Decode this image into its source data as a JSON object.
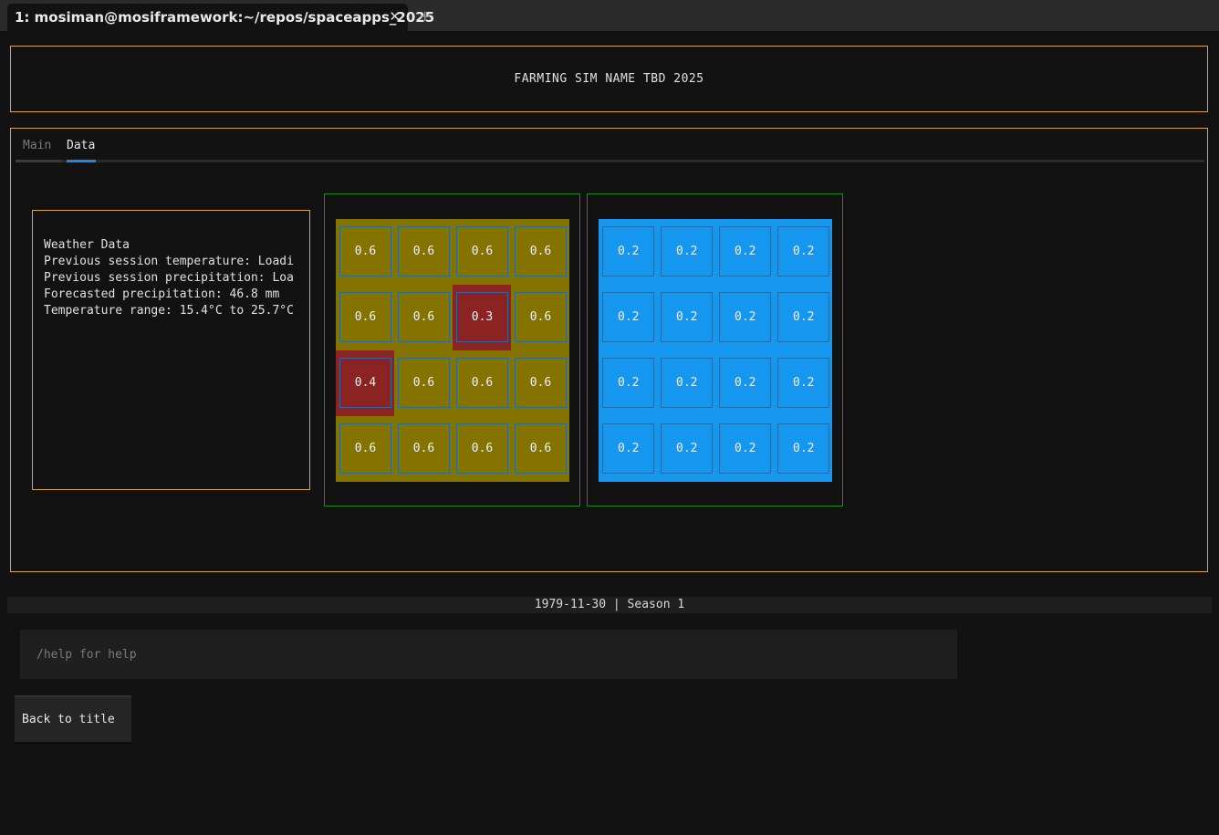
{
  "window": {
    "tab_title": "1: mosiman@mosiframework:~/repos/spaceapps_2025",
    "close_glyph": "✕",
    "new_tab_glyph": "+"
  },
  "app": {
    "title": "FARMING SIM NAME TBD 2025"
  },
  "tabs": [
    {
      "label": "Main",
      "active": false
    },
    {
      "label": "Data",
      "active": true
    }
  ],
  "weather": {
    "heading": "Weather Data",
    "lines": [
      "Previous session temperature: Loadi",
      "Previous session precipitation: Loa",
      "Forecasted precipitation: 46.8 mm",
      "Temperature range: 15.4°C to 25.7°C"
    ]
  },
  "soil_grid": {
    "color": "#857300",
    "highlight_color": "#8b2323",
    "rows": [
      [
        {
          "v": "0.6",
          "h": false
        },
        {
          "v": "0.6",
          "h": false
        },
        {
          "v": "0.6",
          "h": false
        },
        {
          "v": "0.6",
          "h": false
        }
      ],
      [
        {
          "v": "0.6",
          "h": false
        },
        {
          "v": "0.6",
          "h": false
        },
        {
          "v": "0.3",
          "h": true
        },
        {
          "v": "0.6",
          "h": false
        }
      ],
      [
        {
          "v": "0.4",
          "h": true
        },
        {
          "v": "0.6",
          "h": false
        },
        {
          "v": "0.6",
          "h": false
        },
        {
          "v": "0.6",
          "h": false
        }
      ],
      [
        {
          "v": "0.6",
          "h": false
        },
        {
          "v": "0.6",
          "h": false
        },
        {
          "v": "0.6",
          "h": false
        },
        {
          "v": "0.6",
          "h": false
        }
      ]
    ]
  },
  "water_grid": {
    "color": "#1597f0",
    "rows": [
      [
        {
          "v": "0.2",
          "h": false
        },
        {
          "v": "0.2",
          "h": false
        },
        {
          "v": "0.2",
          "h": false
        },
        {
          "v": "0.2",
          "h": false
        }
      ],
      [
        {
          "v": "0.2",
          "h": false
        },
        {
          "v": "0.2",
          "h": false
        },
        {
          "v": "0.2",
          "h": false
        },
        {
          "v": "0.2",
          "h": false
        }
      ],
      [
        {
          "v": "0.2",
          "h": false
        },
        {
          "v": "0.2",
          "h": false
        },
        {
          "v": "0.2",
          "h": false
        },
        {
          "v": "0.2",
          "h": false
        }
      ],
      [
        {
          "v": "0.2",
          "h": false
        },
        {
          "v": "0.2",
          "h": false
        },
        {
          "v": "0.2",
          "h": false
        },
        {
          "v": "0.2",
          "h": false
        }
      ]
    ]
  },
  "status": {
    "text": "1979-11-30 | Season 1"
  },
  "command": {
    "value": "",
    "placeholder": "/help for help"
  },
  "buttons": {
    "back_label": "Back to title"
  },
  "colors": {
    "accent_border": "#d9a24a",
    "grid_border": "#1f8a1f",
    "active_tab": "#1e88e5"
  }
}
